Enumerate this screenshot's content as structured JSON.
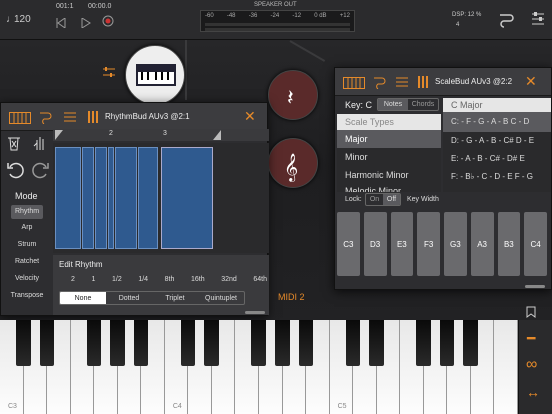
{
  "transport": {
    "tempo": "120",
    "time_sig_counter": "001:1",
    "time": "00:00.0"
  },
  "speaker": {
    "label": "SPEAKER OUT",
    "scale": [
      "-60",
      "-48",
      "-36",
      "-24",
      "-12",
      "0",
      "0 dB",
      "+12"
    ]
  },
  "dsp": {
    "label": "DSP: 12 %",
    "value": "4"
  },
  "rhythm": {
    "title": "RhythmBud AUv3 @2:1",
    "ruler": [
      "2",
      "3"
    ],
    "mode_label": "Mode",
    "modes": [
      "Rhythm",
      "Arp",
      "Strum",
      "Ratchet",
      "Velocity",
      "Transpose"
    ],
    "edit_label": "Edit Rhythm",
    "divisions": [
      "2",
      "1",
      "1/2",
      "1/4",
      "8th",
      "16th",
      "32nd",
      "64th"
    ],
    "feel": [
      "None",
      "Dotted",
      "Triplet",
      "Quintuplet"
    ]
  },
  "scale": {
    "title": "ScaleBud AUv3 @2:2",
    "key_label": "Key: C",
    "tabs": [
      "Notes",
      "Chords"
    ],
    "types_header": "Scale Types",
    "types": [
      "Major",
      "Minor",
      "Harmonic Minor",
      "Melodic Minor"
    ],
    "selected_scale": "C Major",
    "rows": [
      {
        "root": "C:",
        "notes": "- F - G - A - B   C - D"
      },
      {
        "root": "D:",
        "notes": "- G - A - B - C#   D - E"
      },
      {
        "root": "E:",
        "notes": "- A - B - C# - D#   E"
      },
      {
        "root": "F:",
        "notes": "- B♭ - C - D - E   F - G"
      }
    ],
    "lock_label": "Lock:",
    "on": "On",
    "off": "Off",
    "key_width": "Key Width",
    "keys": [
      "C3",
      "D3",
      "E3",
      "F3",
      "G3",
      "A3",
      "B3",
      "C4"
    ]
  },
  "midi_label": "MIDI 2",
  "piano": {
    "labels": [
      "C3",
      "C4",
      "C5"
    ]
  },
  "colors": {
    "accent": "#e58a2a",
    "blue": "#2f5a8f",
    "select": "#5a5a5e"
  }
}
